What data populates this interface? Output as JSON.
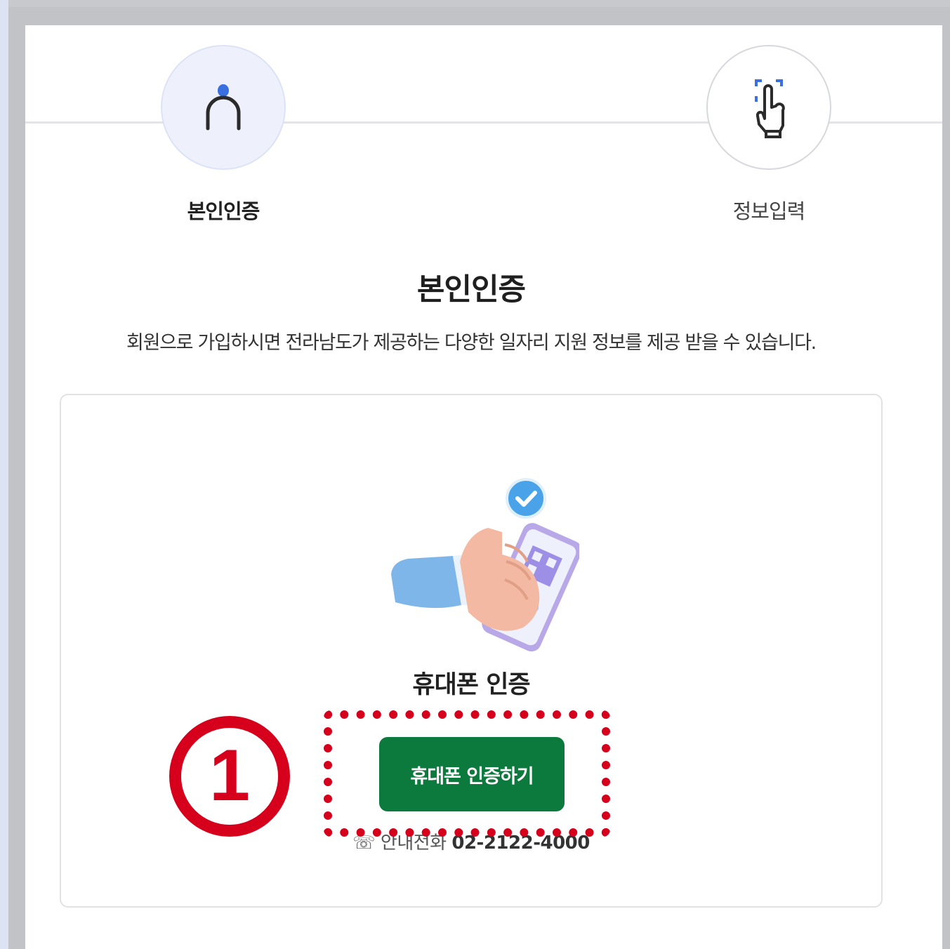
{
  "steps": [
    {
      "label": "본인인증",
      "icon": "person-icon",
      "state": "active"
    },
    {
      "label": "정보입력",
      "icon": "touch-hand-icon",
      "state": "inactive"
    }
  ],
  "main": {
    "title": "본인인증",
    "subtitle": "회원으로 가입하시면 전라남도가 제공하는 다양한 일자리 지원 정보를 제공 받을 수 있습니다."
  },
  "card": {
    "illustration_icon": "phone-verification-illustration",
    "title": "휴대폰 인증",
    "button_label": "휴대폰 인증하기",
    "contact_label": "☏ 안내전화",
    "contact_number": "02-2122-4000"
  },
  "annotation": {
    "marker": "1"
  },
  "colors": {
    "accent_blue": "#3a6fe0",
    "button_green": "#0c7a3c",
    "annotation_red": "#d6001c"
  }
}
